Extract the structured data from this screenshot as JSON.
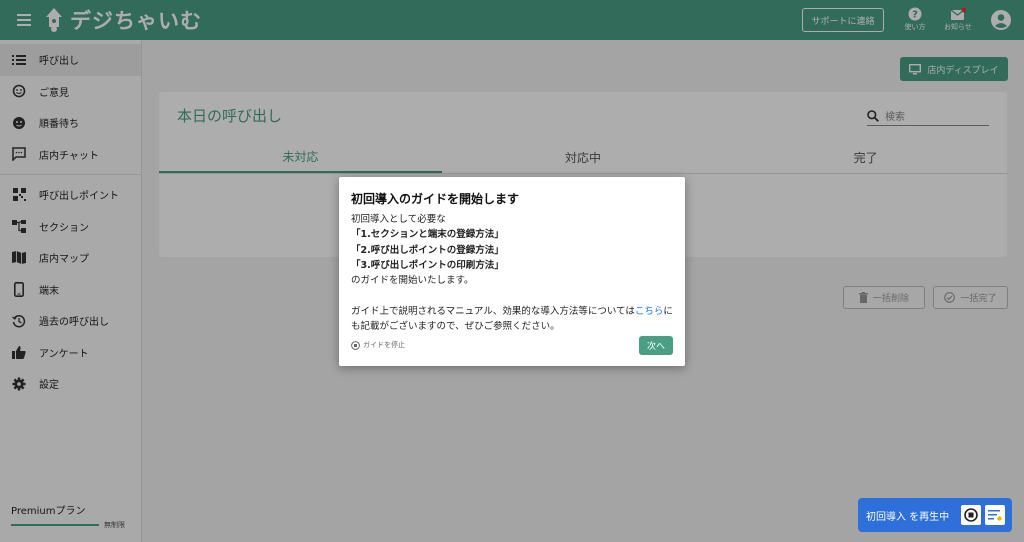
{
  "header": {
    "app_name": "デジちゃいむ",
    "support_label": "サポートに連絡",
    "help_label": "使い方",
    "notice_label": "お知らせ"
  },
  "sidebar": {
    "items": [
      {
        "label": "呼び出し",
        "icon": "list-icon"
      },
      {
        "label": "ご意見",
        "icon": "feedback-icon"
      },
      {
        "label": "順番待ち",
        "icon": "face-icon"
      },
      {
        "label": "店内チャット",
        "icon": "chat-icon"
      },
      {
        "label": "呼び出しポイント",
        "icon": "qr-code-icon"
      },
      {
        "label": "セクション",
        "icon": "section-icon"
      },
      {
        "label": "店内マップ",
        "icon": "map-icon"
      },
      {
        "label": "端末",
        "icon": "phone-icon"
      },
      {
        "label": "過去の呼び出し",
        "icon": "history-icon"
      },
      {
        "label": "アンケート",
        "icon": "thumb-up-icon"
      },
      {
        "label": "設定",
        "icon": "gear-icon"
      }
    ],
    "plan_label": "Premiumプラン",
    "plan_limit": "無制限"
  },
  "main": {
    "display_button": "店内ディスプレイ",
    "card_title": "本日の呼び出し",
    "search_placeholder": "検索",
    "tabs": [
      "未対応",
      "対応中",
      "完了"
    ],
    "bulk_delete": "一括削除",
    "bulk_complete": "一括完了"
  },
  "modal": {
    "title": "初回導入のガイドを開始します",
    "line1": "初回導入として必要な",
    "line2": "「1.セクションと端末の登録方法」",
    "line3": "「2.呼び出しポイントの登録方法」",
    "line4": "「3.呼び出しポイントの印刷方法」",
    "line5": "のガイドを開始いたします。",
    "line6a": "ガイド上で説明されるマニュアル、効果的な導入方法等については",
    "line6_link": "こちら",
    "line6b": "にも記載がございますので、ぜひご参照ください。",
    "stop_label": "ガイドを停止",
    "next_label": "次へ"
  },
  "replay": {
    "label": "初回導入 を再生中"
  },
  "colors": {
    "brand": "#4a9e84",
    "replay_blue": "#2f6fd9",
    "link": "#1a73e8"
  }
}
